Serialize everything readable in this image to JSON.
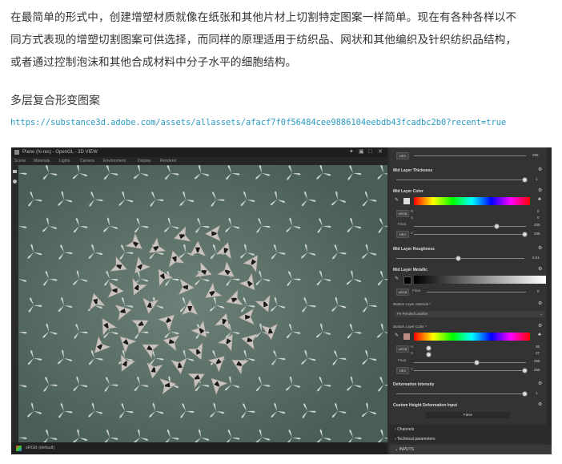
{
  "article": {
    "lines": [
      "在最简单的形式中，创建增塑材质就像在纸张和其他片材上切割特定图案一样简单。现在有各种各样以不",
      "同方式表现的增塑切割图案可供选择，而同样的原理适用于纺织品、网状和其他编织及针织纺织品结构，",
      "或者通过控制泡沫和其他合成材料中分子水平的细胞结构。"
    ],
    "heading": "多层复合形变图案",
    "link": "https://substance3d.adobe.com/assets/allassets/afacf7f0f56484cee9886104eebdb43fcadbc2b0?recent=true"
  },
  "screenshot": {
    "window_title": "Plane (hi-res) - OpenGL - 3D VIEW",
    "menu": [
      "Scene",
      "Materials",
      "Lights",
      "Camera",
      "Environment",
      "Display",
      "Renderer"
    ],
    "status": "sRGB (default)",
    "panel": {
      "top_values": [
        "255"
      ],
      "mid_thickness": {
        "label": "Mid Layer Thickness",
        "value": "1"
      },
      "mid_color": {
        "label": "Mid Layer Color",
        "rows": [
          {
            "tag": "sRGB",
            "letter": "R",
            "value": "0"
          },
          {
            "tag": "",
            "letter": "S",
            "value": "0"
          },
          {
            "tag": "Float",
            "letter": "",
            "value": "205"
          },
          {
            "tag": "HEX",
            "letter": "V",
            "value": "205"
          }
        ]
      },
      "mid_roughness": {
        "label": "Mid Layer Roughness",
        "value": "0.51"
      },
      "mid_metallic": {
        "label": "Mid Layer Metallic",
        "tag": "sRGB",
        "float": "Float",
        "value": "0"
      },
      "bottom_material": {
        "label": "Bottom Layer Material *",
        "value": "Fe Peruled Leather"
      },
      "bottom_color": {
        "label": "Bottom Layer Color *",
        "rows": [
          {
            "tag": "sRGB",
            "letter": "H",
            "value": "36"
          },
          {
            "tag": "",
            "letter": "S",
            "value": "27"
          },
          {
            "tag": "Float",
            "letter": "",
            "value": "255"
          },
          {
            "tag": "HEX",
            "letter": "V",
            "value": "255"
          }
        ]
      },
      "deformation": {
        "label": "Deformation Intensity",
        "value": "1"
      },
      "custom_height": {
        "label": "Custom Height Deformation Input",
        "value": "False"
      },
      "sections": [
        "Channels",
        "Technical parameters",
        "INPUTS"
      ]
    }
  }
}
